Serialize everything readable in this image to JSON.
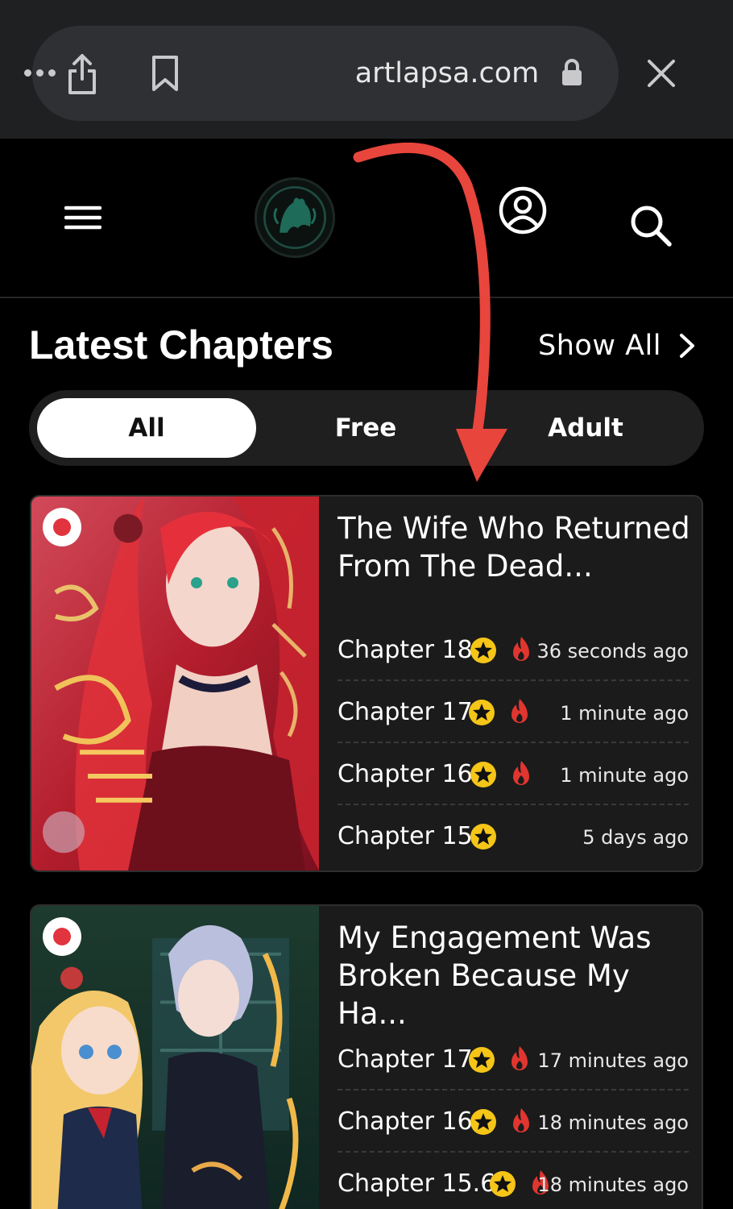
{
  "browser": {
    "url": "artlapsa.com"
  },
  "section": {
    "title": "Latest Chapters",
    "show_all": "Show All"
  },
  "tabs": [
    {
      "label": "All",
      "active": true
    },
    {
      "label": "Free",
      "active": false
    },
    {
      "label": "Adult",
      "active": false
    }
  ],
  "colors": {
    "badge_red": "#e1343f",
    "star_yellow": "#f5c518",
    "fire_red": "#e0362f",
    "annotation_arrow": "#e8453c"
  },
  "series": [
    {
      "title": "The Wife Who Returned From The Dead...",
      "chapters": [
        {
          "label": "Chapter 18",
          "time": "36 seconds ago",
          "star": true,
          "hot": true
        },
        {
          "label": "Chapter 17",
          "time": "1 minute ago",
          "star": true,
          "hot": true
        },
        {
          "label": "Chapter 16",
          "time": "1 minute ago",
          "star": true,
          "hot": true
        },
        {
          "label": "Chapter 15",
          "time": "5 days ago",
          "star": true,
          "hot": false
        }
      ]
    },
    {
      "title": "My Engagement Was Broken Because My Ha...",
      "chapters": [
        {
          "label": "Chapter 17",
          "time": "17 minutes ago",
          "star": true,
          "hot": true
        },
        {
          "label": "Chapter 16",
          "time": "18 minutes ago",
          "star": true,
          "hot": true
        },
        {
          "label": "Chapter 15.6",
          "time": "18 minutes ago",
          "star": true,
          "hot": true
        }
      ]
    }
  ]
}
